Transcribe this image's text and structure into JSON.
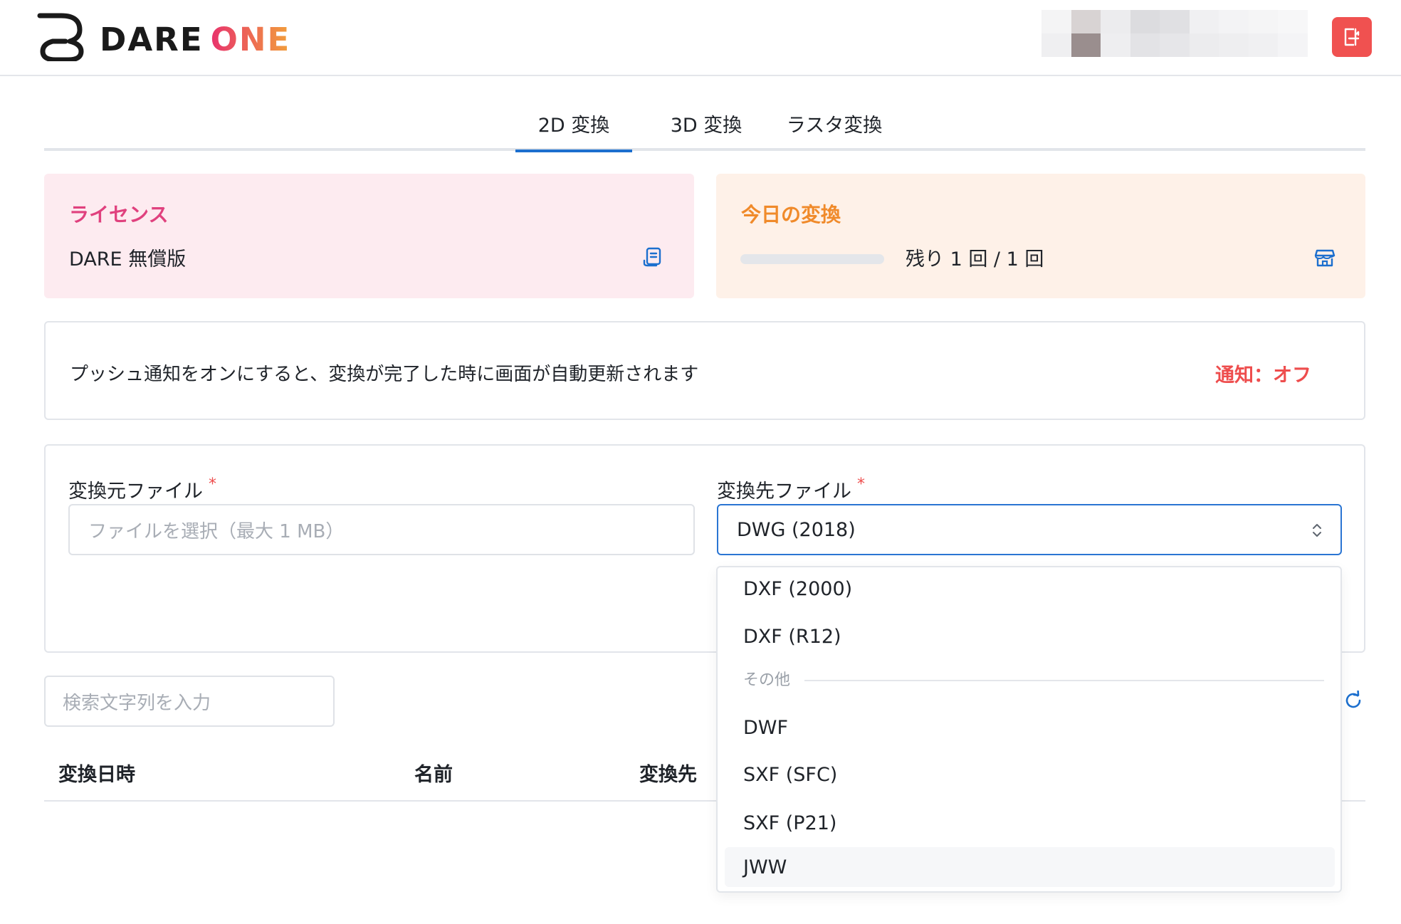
{
  "header": {
    "logo_part1": "DARE",
    "logo_part2": "ONE",
    "logout_label": "logout"
  },
  "tabs": [
    {
      "label": "2D 変換",
      "active": true
    },
    {
      "label": "3D 変換",
      "active": false
    },
    {
      "label": "ラスタ変換",
      "active": false
    }
  ],
  "license_card": {
    "title": "ライセンス",
    "value": "DARE 無償版",
    "icon": "document-list-icon"
  },
  "today_card": {
    "title": "今日の変換",
    "remaining_text": "残り 1 回 / 1 回",
    "progress_fraction": 0,
    "icon": "store-icon"
  },
  "notification": {
    "message": "プッシュ通知をオンにすると、変換が完了した時に画面が自動更新されます",
    "toggle_label": "通知：オフ"
  },
  "form": {
    "source_label": "変換元ファイル",
    "source_placeholder": "ファイルを選択（最大 1 MB）",
    "target_label": "変換先ファイル",
    "target_value": "DWG (2018)",
    "required_mark": "*"
  },
  "dropdown": {
    "options_top": [
      "DXF (2000)",
      "DXF (R12)"
    ],
    "group_label": "その他",
    "options_other": [
      "DWF",
      "SXF (SFC)",
      "SXF (P21)",
      "JWW"
    ],
    "hovered": "JWW"
  },
  "search": {
    "placeholder": "検索文字列を入力"
  },
  "table": {
    "columns": [
      "変換日時",
      "名前",
      "変換先"
    ]
  },
  "colors": {
    "accent_blue": "#1c6fce",
    "license_pink": "#e0417e",
    "today_orange": "#f08a2a",
    "alert_red": "#ee4d4d",
    "logout_red": "#f05150"
  }
}
